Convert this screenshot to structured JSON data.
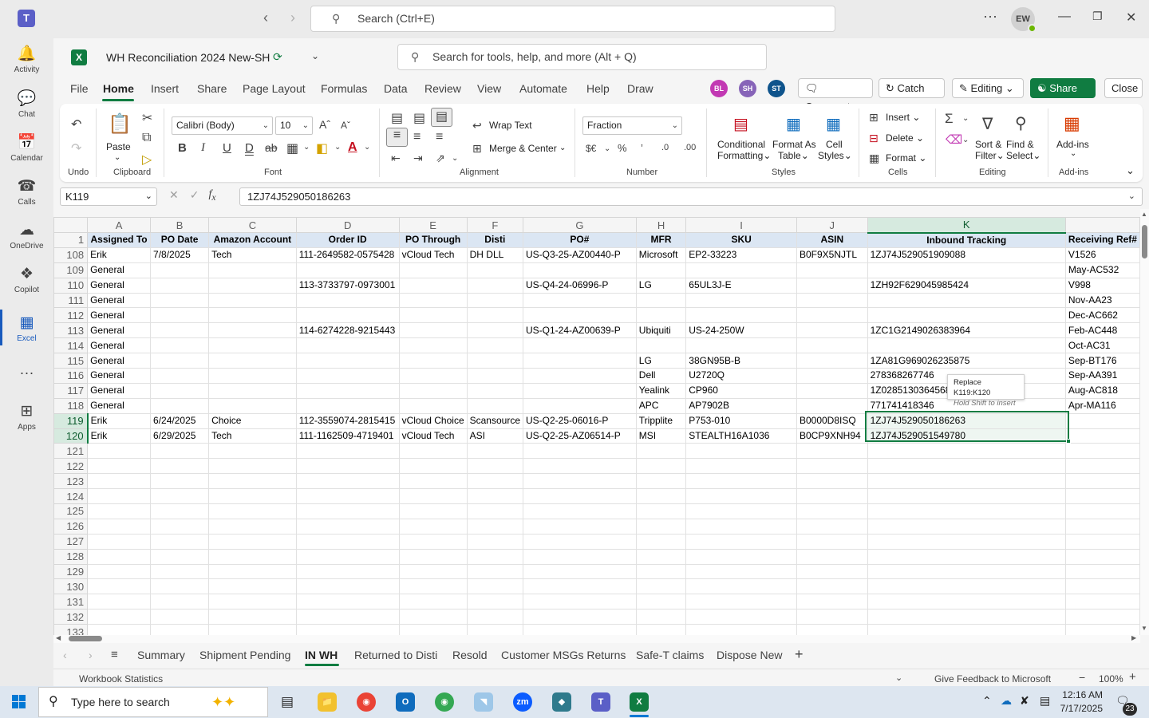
{
  "teams": {
    "search_placeholder": "Search (Ctrl+E)",
    "user_initials": "EW",
    "rail": [
      {
        "label": "Activity",
        "icon": "bell-icon"
      },
      {
        "label": "Chat",
        "icon": "chat-icon"
      },
      {
        "label": "Calendar",
        "icon": "calendar-icon"
      },
      {
        "label": "Calls",
        "icon": "phone-icon"
      },
      {
        "label": "OneDrive",
        "icon": "cloud-icon"
      },
      {
        "label": "Copilot",
        "icon": "copilot-icon"
      },
      {
        "label": "Excel",
        "icon": "excel-icon"
      },
      {
        "label": "Apps",
        "icon": "add-icon"
      }
    ]
  },
  "excel": {
    "doc_title": "WH Reconciliation 2024 New-SH",
    "tool_search_placeholder": "Search for tools, help, and more (Alt + Q)",
    "menu_tabs": [
      "File",
      "Home",
      "Insert",
      "Share",
      "Page Layout",
      "Formulas",
      "Data",
      "Review",
      "View",
      "Automate",
      "Help",
      "Draw"
    ],
    "active_tab": "Home",
    "collaborators": [
      {
        "initials": "BL",
        "color": "#c239b3"
      },
      {
        "initials": "SH",
        "color": "#8764b8"
      },
      {
        "initials": "ST",
        "color": "#0f548c"
      }
    ],
    "buttons": {
      "comments": "Comments",
      "catch_up": "Catch up",
      "editing": "Editing",
      "share": "Share",
      "close": "Close"
    },
    "ribbon": {
      "undo_group": "Undo",
      "paste": "Paste",
      "clipboard_group": "Clipboard",
      "font_name": "Calibri (Body)",
      "font_size": "10",
      "font_group": "Font",
      "wrap_text": "Wrap Text",
      "merge_center": "Merge & Center",
      "alignment_group": "Alignment",
      "number_format": "Fraction",
      "number_group": "Number",
      "conditional_formatting_1": "Conditional",
      "conditional_formatting_2": "Formatting",
      "format_as_table_1": "Format As",
      "format_as_table_2": "Table",
      "cell_styles_1": "Cell",
      "cell_styles_2": "Styles",
      "styles_group": "Styles",
      "insert": "Insert",
      "delete": "Delete",
      "format": "Format",
      "cells_group": "Cells",
      "sort_filter_1": "Sort &",
      "sort_filter_2": "Filter",
      "find_select_1": "Find &",
      "find_select_2": "Select",
      "editing_group": "Editing",
      "addins": "Add-ins",
      "addins_group": "Add-ins"
    },
    "name_box": "K119",
    "formula": "1ZJ74J529050186263",
    "columns": [
      "A",
      "B",
      "C",
      "D",
      "E",
      "F",
      "G",
      "H",
      "I",
      "J",
      "K",
      "Receiving Ref#"
    ],
    "column_letters": [
      "A",
      "B",
      "C",
      "D",
      "E",
      "F",
      "G",
      "H",
      "I",
      "J",
      "K"
    ],
    "headers": [
      "Assigned To",
      "PO Date",
      "Amazon Account",
      "Order ID",
      "PO Through",
      "Disti",
      "PO#",
      "MFR",
      "SKU",
      "ASIN",
      "Inbound Tracking",
      "Receiving Ref#"
    ],
    "rows": [
      {
        "num": "108",
        "cells": [
          "Erik",
          "7/8/2025",
          "Tech",
          "111-2649582-0575428",
          "vCloud Tech",
          "DH DLL",
          "US-Q3-25-AZ00440-P",
          "Microsoft",
          "EP2-33223",
          "B0F9X5NJTL",
          "1ZJ74J529051909088",
          "V1526"
        ]
      },
      {
        "num": "109",
        "cells": [
          "General",
          "",
          "",
          "",
          "",
          "",
          "",
          "",
          "",
          "",
          "",
          "May-AC532"
        ]
      },
      {
        "num": "110",
        "cells": [
          "General",
          "",
          "",
          "113-3733797-0973001",
          "",
          "",
          "US-Q4-24-06996-P",
          "LG",
          "65UL3J-E",
          "",
          "1ZH92F629045985424",
          "V998"
        ]
      },
      {
        "num": "111",
        "cells": [
          "General",
          "",
          "",
          "",
          "",
          "",
          "",
          "",
          "",
          "",
          "",
          "Nov-AA23"
        ]
      },
      {
        "num": "112",
        "cells": [
          "General",
          "",
          "",
          "",
          "",
          "",
          "",
          "",
          "",
          "",
          "",
          "Dec-AC662"
        ]
      },
      {
        "num": "113",
        "cells": [
          "General",
          "",
          "",
          "114-6274228-9215443",
          "",
          "",
          "US-Q1-24-AZ00639-P",
          "Ubiquiti",
          "US-24-250W",
          "",
          "1ZC1G2149026383964",
          "Feb-AC448"
        ]
      },
      {
        "num": "114",
        "cells": [
          "General",
          "",
          "",
          "",
          "",
          "",
          "",
          "",
          "",
          "",
          "",
          "Oct-AC31"
        ]
      },
      {
        "num": "115",
        "cells": [
          "General",
          "",
          "",
          "",
          "",
          "",
          "",
          "LG",
          "38GN95B-B",
          "",
          "1ZA81G969026235875",
          "Sep-BT176"
        ]
      },
      {
        "num": "116",
        "cells": [
          "General",
          "",
          "",
          "",
          "",
          "",
          "",
          "Dell",
          "U2720Q",
          "",
          "278368267746",
          "Sep-AA391"
        ]
      },
      {
        "num": "117",
        "cells": [
          "General",
          "",
          "",
          "",
          "",
          "",
          "",
          "Yealink",
          "CP960",
          "",
          "1Z0285130364568",
          "Aug-AC818"
        ]
      },
      {
        "num": "118",
        "cells": [
          "General",
          "",
          "",
          "",
          "",
          "",
          "",
          "APC",
          "AP7902B",
          "",
          "771741418346",
          "Apr-MA116"
        ]
      },
      {
        "num": "119",
        "cells": [
          "Erik",
          "6/24/2025",
          "Choice",
          "112-3559074-2815415",
          "vCloud Choice",
          "Scansource",
          "US-Q2-25-06016-P",
          "Tripplite",
          "P753-010",
          "B0000D8ISQ",
          "1ZJ74J529050186263",
          ""
        ]
      },
      {
        "num": "120",
        "cells": [
          "Erik",
          "6/29/2025",
          "Tech",
          "111-1162509-4719401",
          "vCloud Tech",
          "ASI",
          "US-Q2-25-AZ06514-P",
          "MSI",
          "STEALTH16A1036",
          "B0CP9XNH94",
          "1ZJ74J529051549780",
          ""
        ]
      },
      {
        "num": "121",
        "cells": [
          "",
          "",
          "",
          "",
          "",
          "",
          "",
          "",
          "",
          "",
          "",
          ""
        ]
      },
      {
        "num": "122",
        "cells": [
          "",
          "",
          "",
          "",
          "",
          "",
          "",
          "",
          "",
          "",
          "",
          ""
        ]
      },
      {
        "num": "123",
        "cells": [
          "",
          "",
          "",
          "",
          "",
          "",
          "",
          "",
          "",
          "",
          "",
          ""
        ]
      },
      {
        "num": "124",
        "cells": [
          "",
          "",
          "",
          "",
          "",
          "",
          "",
          "",
          "",
          "",
          "",
          ""
        ]
      },
      {
        "num": "125",
        "cells": [
          "",
          "",
          "",
          "",
          "",
          "",
          "",
          "",
          "",
          "",
          "",
          ""
        ]
      },
      {
        "num": "126",
        "cells": [
          "",
          "",
          "",
          "",
          "",
          "",
          "",
          "",
          "",
          "",
          "",
          ""
        ]
      },
      {
        "num": "127",
        "cells": [
          "",
          "",
          "",
          "",
          "",
          "",
          "",
          "",
          "",
          "",
          "",
          ""
        ]
      },
      {
        "num": "128",
        "cells": [
          "",
          "",
          "",
          "",
          "",
          "",
          "",
          "",
          "",
          "",
          "",
          ""
        ]
      },
      {
        "num": "129",
        "cells": [
          "",
          "",
          "",
          "",
          "",
          "",
          "",
          "",
          "",
          "",
          "",
          ""
        ]
      },
      {
        "num": "130",
        "cells": [
          "",
          "",
          "",
          "",
          "",
          "",
          "",
          "",
          "",
          "",
          "",
          ""
        ]
      },
      {
        "num": "131",
        "cells": [
          "",
          "",
          "",
          "",
          "",
          "",
          "",
          "",
          "",
          "",
          "",
          ""
        ]
      },
      {
        "num": "132",
        "cells": [
          "",
          "",
          "",
          "",
          "",
          "",
          "",
          "",
          "",
          "",
          "",
          ""
        ]
      },
      {
        "num": "133",
        "cells": [
          "",
          "",
          "",
          "",
          "",
          "",
          "",
          "",
          "",
          "",
          "",
          ""
        ]
      }
    ],
    "selected_rows": [
      "119",
      "120"
    ],
    "selected_column": "K",
    "tooltip": {
      "title": "Replace K119:K120",
      "subtitle": "Hold Shift to insert"
    },
    "sheet_tabs": [
      "Summary",
      "Shipment Pending",
      "IN WH",
      "Returned to Disti",
      "Resold",
      "Customer MSGs Returns",
      "Safe-T claims",
      "Dispose New"
    ],
    "active_sheet": "IN WH",
    "status": {
      "left": "Workbook Statistics",
      "feedback": "Give Feedback to Microsoft",
      "zoom": "100%"
    }
  },
  "taskbar": {
    "search_placeholder": "Type here to search",
    "time": "12:16 AM",
    "date": "7/17/2025",
    "notifications": "23"
  }
}
